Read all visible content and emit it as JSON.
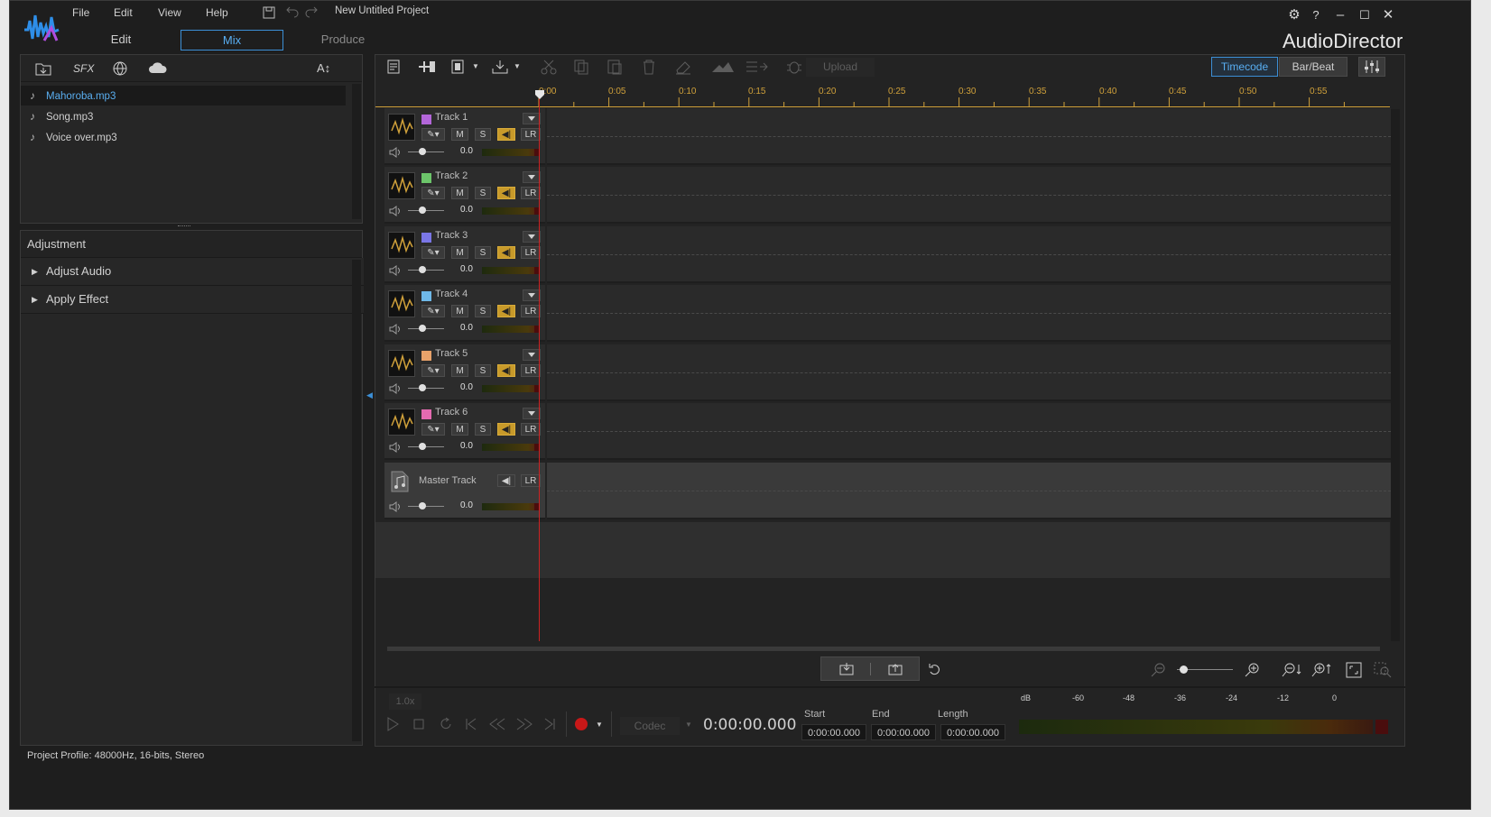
{
  "app": {
    "title": "AudioDirector",
    "project": "New Untitled Project"
  },
  "menu": [
    "File",
    "Edit",
    "View",
    "Help"
  ],
  "modes": {
    "edit": "Edit",
    "mix": "Mix",
    "produce": "Produce"
  },
  "library": {
    "sfx_label": "SFX",
    "font_label": "A↕",
    "items": [
      {
        "name": "Mahoroba.mp3",
        "selected": true
      },
      {
        "name": "Song.mp3",
        "selected": false
      },
      {
        "name": "Voice over.mp3",
        "selected": false
      }
    ]
  },
  "adjustment": {
    "title": "Adjustment",
    "sections": [
      "Adjust Audio",
      "Apply Effect"
    ]
  },
  "status": {
    "profile": "Project Profile: 48000Hz, 16-bits, Stereo"
  },
  "toolbar": {
    "upload_label": "Upload",
    "timecode_label": "Timecode",
    "barbeat_label": "Bar/Beat",
    "timecode_active": true
  },
  "ruler": {
    "labels": [
      "0:00",
      "0:05",
      "0:10",
      "0:15",
      "0:20",
      "0:25",
      "0:30",
      "0:35",
      "0:40",
      "0:45",
      "0:50",
      "0:55"
    ]
  },
  "tracks": [
    {
      "name": "Track 1",
      "color": "#b366d9",
      "mute": "M",
      "solo": "S",
      "lr": "LR",
      "volume": "0.0"
    },
    {
      "name": "Track 2",
      "color": "#6cc56a",
      "mute": "M",
      "solo": "S",
      "lr": "LR",
      "volume": "0.0"
    },
    {
      "name": "Track 3",
      "color": "#7a76e6",
      "mute": "M",
      "solo": "S",
      "lr": "LR",
      "volume": "0.0"
    },
    {
      "name": "Track 4",
      "color": "#6fb8e8",
      "mute": "M",
      "solo": "S",
      "lr": "LR",
      "volume": "0.0"
    },
    {
      "name": "Track 5",
      "color": "#e8a26a",
      "mute": "M",
      "solo": "S",
      "lr": "LR",
      "volume": "0.0"
    },
    {
      "name": "Track 6",
      "color": "#e46ab0",
      "mute": "M",
      "solo": "S",
      "lr": "LR",
      "volume": "0.0"
    }
  ],
  "master": {
    "name": "Master Track",
    "lr": "LR",
    "volume": "0.0"
  },
  "transport": {
    "speed": "1.0x",
    "codec": "Codec",
    "time": "0:00:00.000",
    "start_label": "Start",
    "start": "0:00:00.000",
    "end_label": "End",
    "end": "0:00:00.000",
    "length_label": "Length",
    "length": "0:00:00.000"
  },
  "meter_scale": {
    "db": "dB",
    "ticks": [
      "-60",
      "-48",
      "-36",
      "-24",
      "-12",
      "0"
    ]
  },
  "colors": {
    "accent": "#3c8fd6",
    "playhead": "#cc2222",
    "ruler": "#cfa03a",
    "mute_active": "#c89a2a"
  }
}
